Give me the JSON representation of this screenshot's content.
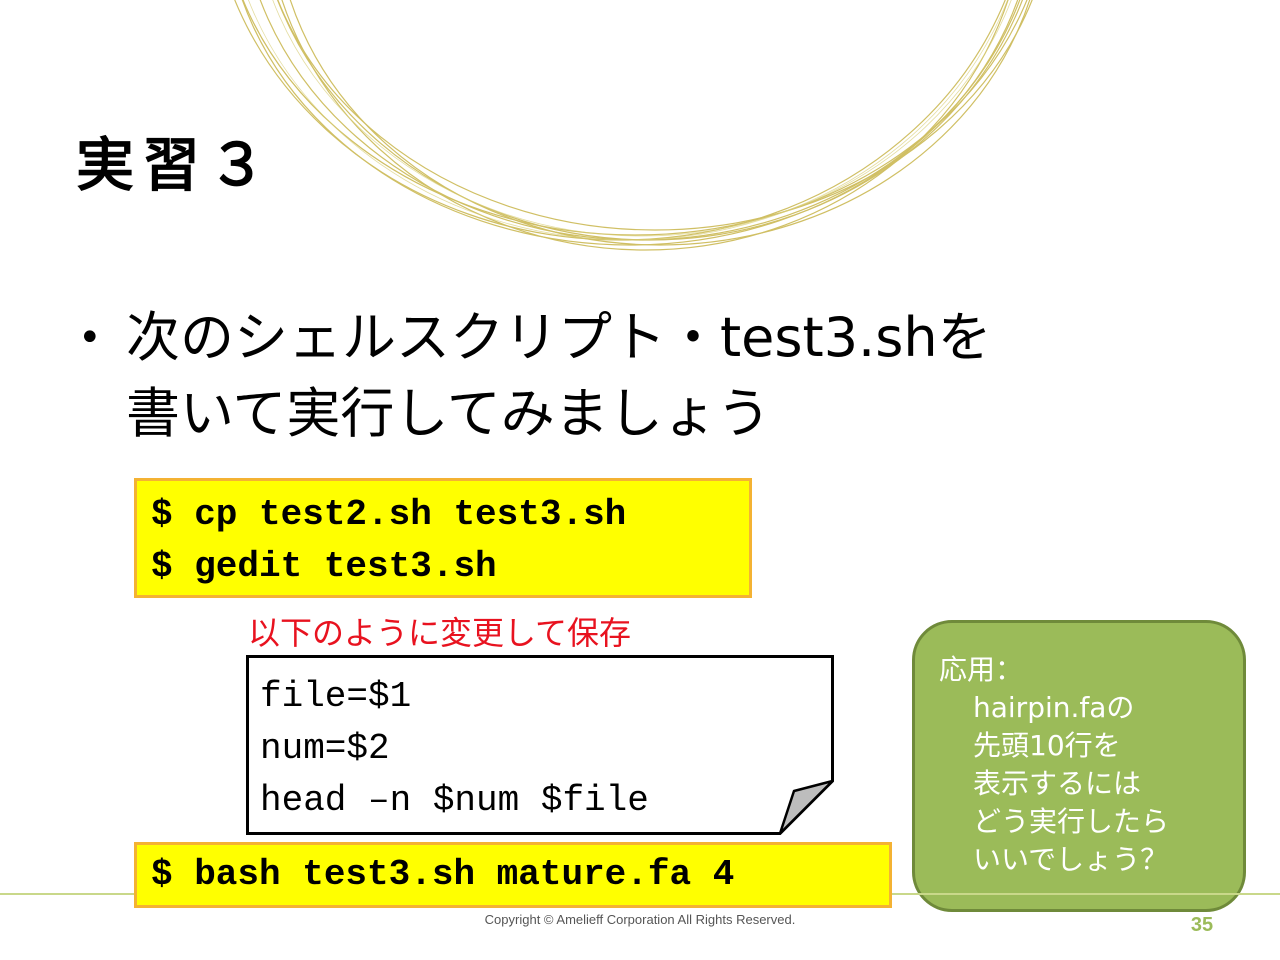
{
  "slide": {
    "title": "実習３",
    "bullet_lines": [
      "次のシェルスクリプト・test3.shを",
      "書いて実行してみましょう"
    ],
    "bullet_symbol": "•",
    "command_box_1": [
      "$ cp test2.sh test3.sh",
      "$ gedit test3.sh"
    ],
    "instruction": "以下のように変更して保存",
    "script_lines": [
      "file=$1",
      "num=$2",
      "head –n $num $file"
    ],
    "command_box_2": [
      "$ bash test3.sh mature.fa 4"
    ],
    "application_box": {
      "heading": "応用：",
      "lines": [
        "hairpin.faの",
        "先頭10行を",
        "表示するには",
        "どう実行したら",
        "いいでしょう？"
      ]
    },
    "copyright": "Copyright © Amelieff Corporation All Rights Reserved.",
    "page_number": "35"
  },
  "colors": {
    "command_box_fill": "#ffff00",
    "command_box_border": "#f4b233",
    "instruction_text": "#e8121f",
    "application_box_fill": "#9bbb59",
    "rings": "#c8b54a",
    "page_number": "#9bbb59"
  }
}
